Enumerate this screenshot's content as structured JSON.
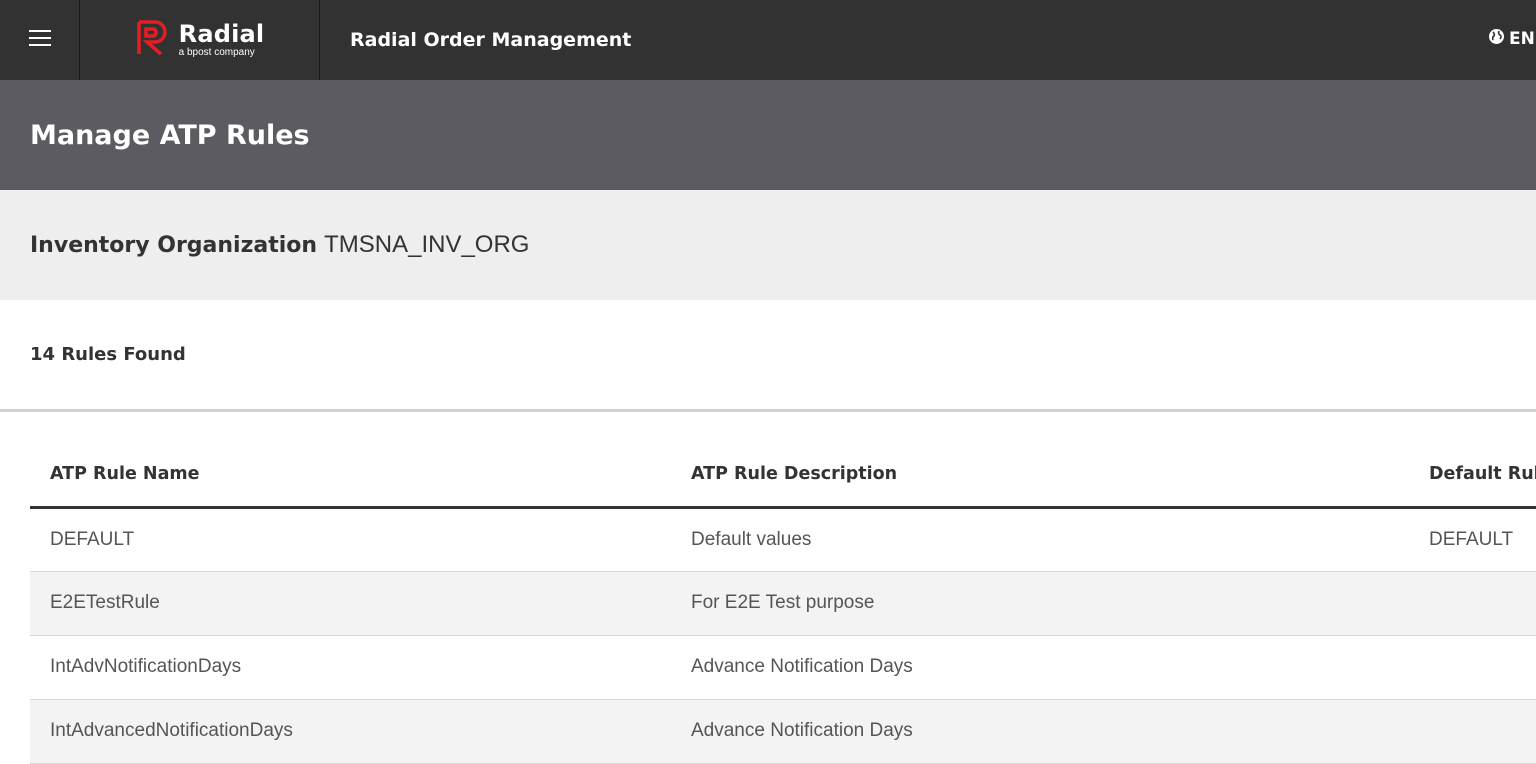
{
  "nav": {
    "menu_icon": "hamburger-menu-icon",
    "logo": {
      "word": "Radial",
      "tagline": "a bpost company",
      "brand_color": "#e31e24"
    },
    "app_title": "Radial Order Management",
    "language": {
      "icon": "globe-icon",
      "code": "EN"
    }
  },
  "page": {
    "title": "Manage ATP Rules"
  },
  "organization": {
    "label": "Inventory Organization",
    "value": "TMSNA_INV_ORG"
  },
  "results": {
    "count_text": "14 Rules Found"
  },
  "table": {
    "columns": [
      "ATP Rule Name",
      "ATP Rule Description",
      "Default Rul"
    ],
    "rows": [
      [
        "DEFAULT",
        "Default values",
        "DEFAULT"
      ],
      [
        "E2ETestRule",
        "For E2E Test purpose",
        ""
      ],
      [
        "IntAdvNotificationDays",
        "Advance Notification Days",
        ""
      ],
      [
        "IntAdvancedNotificationDays",
        "Advance Notification Days",
        ""
      ]
    ]
  },
  "colors": {
    "topbar": "#323232",
    "page_header": "#5b5b61",
    "org_band": "#eeeeee",
    "brand_red": "#e31e24"
  }
}
